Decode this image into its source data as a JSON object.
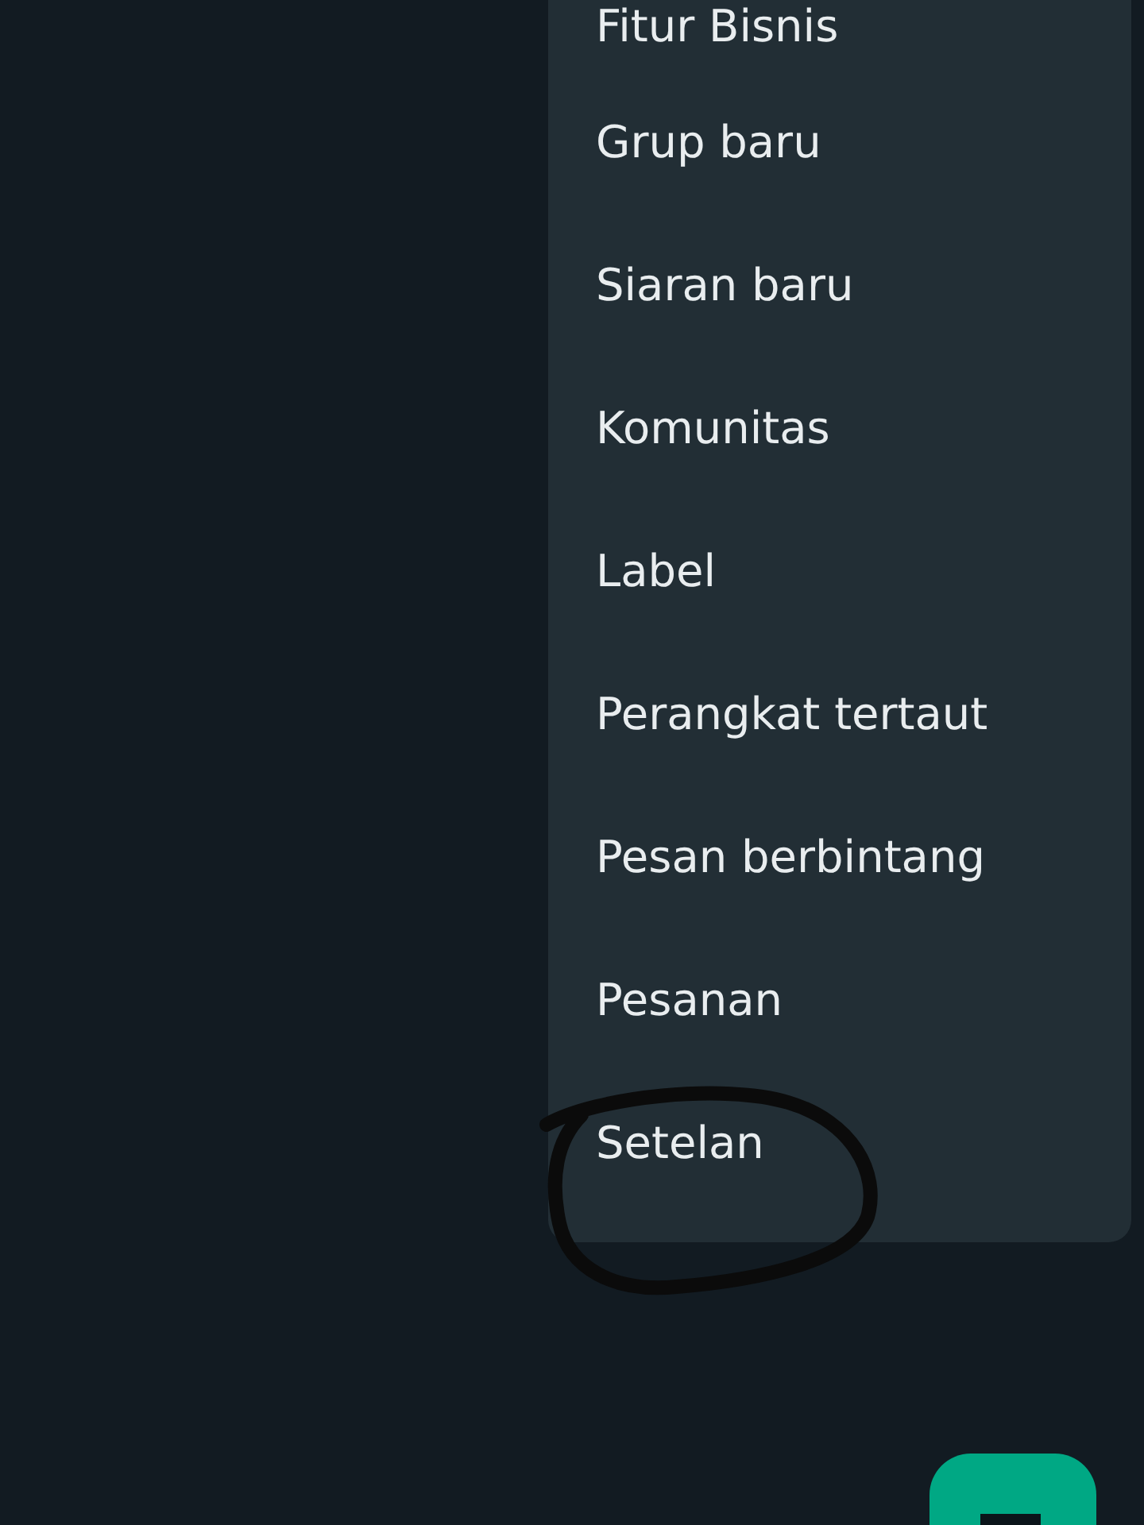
{
  "menu": {
    "items": [
      {
        "label": "Fitur Bisnis"
      },
      {
        "label": "Grup baru"
      },
      {
        "label": "Siaran baru"
      },
      {
        "label": "Komunitas"
      },
      {
        "label": "Label"
      },
      {
        "label": "Perangkat tertaut"
      },
      {
        "label": "Pesan berbintang"
      },
      {
        "label": "Pesanan"
      },
      {
        "label": "Setelan"
      }
    ]
  }
}
